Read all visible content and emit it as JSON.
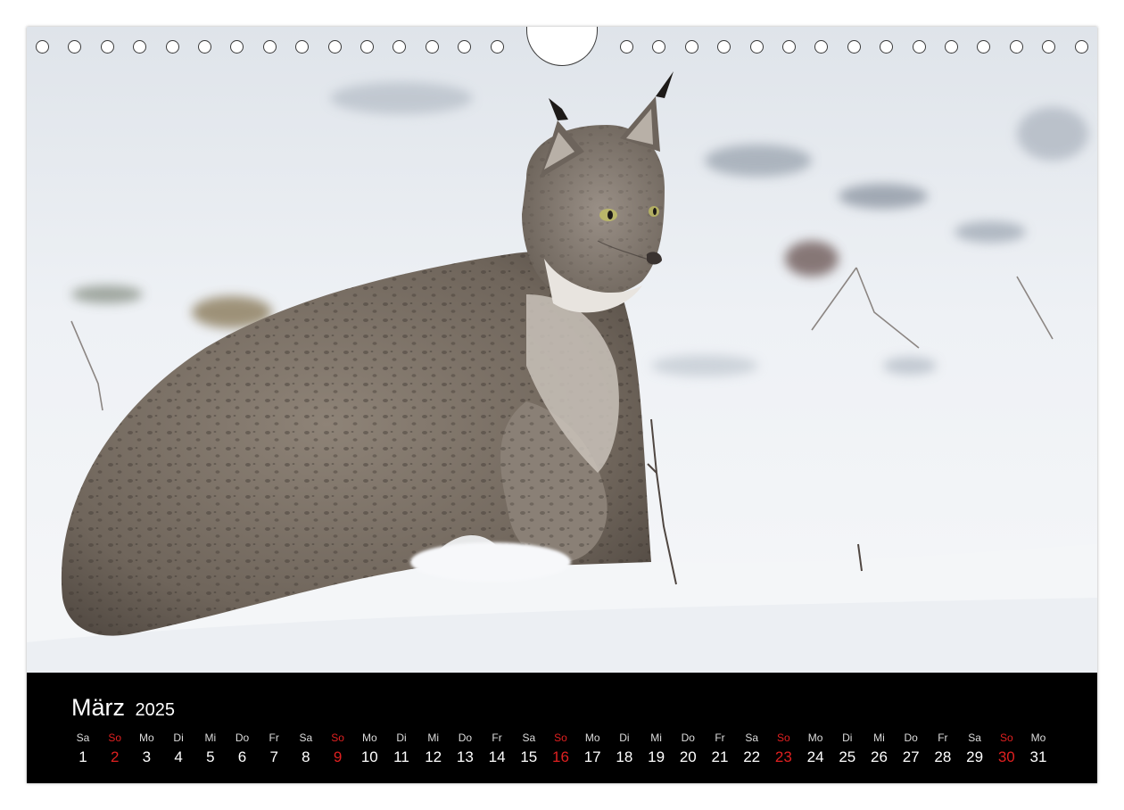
{
  "calendar": {
    "month": "März",
    "year": "2025",
    "accent_color": "#e02020",
    "days": [
      {
        "dow": "Sa",
        "num": "1",
        "sunday": false
      },
      {
        "dow": "So",
        "num": "2",
        "sunday": true
      },
      {
        "dow": "Mo",
        "num": "3",
        "sunday": false
      },
      {
        "dow": "Di",
        "num": "4",
        "sunday": false
      },
      {
        "dow": "Mi",
        "num": "5",
        "sunday": false
      },
      {
        "dow": "Do",
        "num": "6",
        "sunday": false
      },
      {
        "dow": "Fr",
        "num": "7",
        "sunday": false
      },
      {
        "dow": "Sa",
        "num": "8",
        "sunday": false
      },
      {
        "dow": "So",
        "num": "9",
        "sunday": true
      },
      {
        "dow": "Mo",
        "num": "10",
        "sunday": false
      },
      {
        "dow": "Di",
        "num": "11",
        "sunday": false
      },
      {
        "dow": "Mi",
        "num": "12",
        "sunday": false
      },
      {
        "dow": "Do",
        "num": "13",
        "sunday": false
      },
      {
        "dow": "Fr",
        "num": "14",
        "sunday": false
      },
      {
        "dow": "Sa",
        "num": "15",
        "sunday": false
      },
      {
        "dow": "So",
        "num": "16",
        "sunday": true
      },
      {
        "dow": "Mo",
        "num": "17",
        "sunday": false
      },
      {
        "dow": "Di",
        "num": "18",
        "sunday": false
      },
      {
        "dow": "Mi",
        "num": "19",
        "sunday": false
      },
      {
        "dow": "Do",
        "num": "20",
        "sunday": false
      },
      {
        "dow": "Fr",
        "num": "21",
        "sunday": false
      },
      {
        "dow": "Sa",
        "num": "22",
        "sunday": false
      },
      {
        "dow": "So",
        "num": "23",
        "sunday": true
      },
      {
        "dow": "Mo",
        "num": "24",
        "sunday": false
      },
      {
        "dow": "Di",
        "num": "25",
        "sunday": false
      },
      {
        "dow": "Mi",
        "num": "26",
        "sunday": false
      },
      {
        "dow": "Do",
        "num": "27",
        "sunday": false
      },
      {
        "dow": "Fr",
        "num": "28",
        "sunday": false
      },
      {
        "dow": "Sa",
        "num": "29",
        "sunday": false
      },
      {
        "dow": "So",
        "num": "30",
        "sunday": true
      },
      {
        "dow": "Mo",
        "num": "31",
        "sunday": false
      }
    ]
  },
  "photo": {
    "subject": "lynx-in-snow",
    "colors": {
      "snow": "#f2f4f7",
      "snow_shadow": "#d5dbe3",
      "fur": "#7d7266",
      "fur_dark": "#4e4640",
      "fur_light": "#bdb6ad"
    }
  }
}
